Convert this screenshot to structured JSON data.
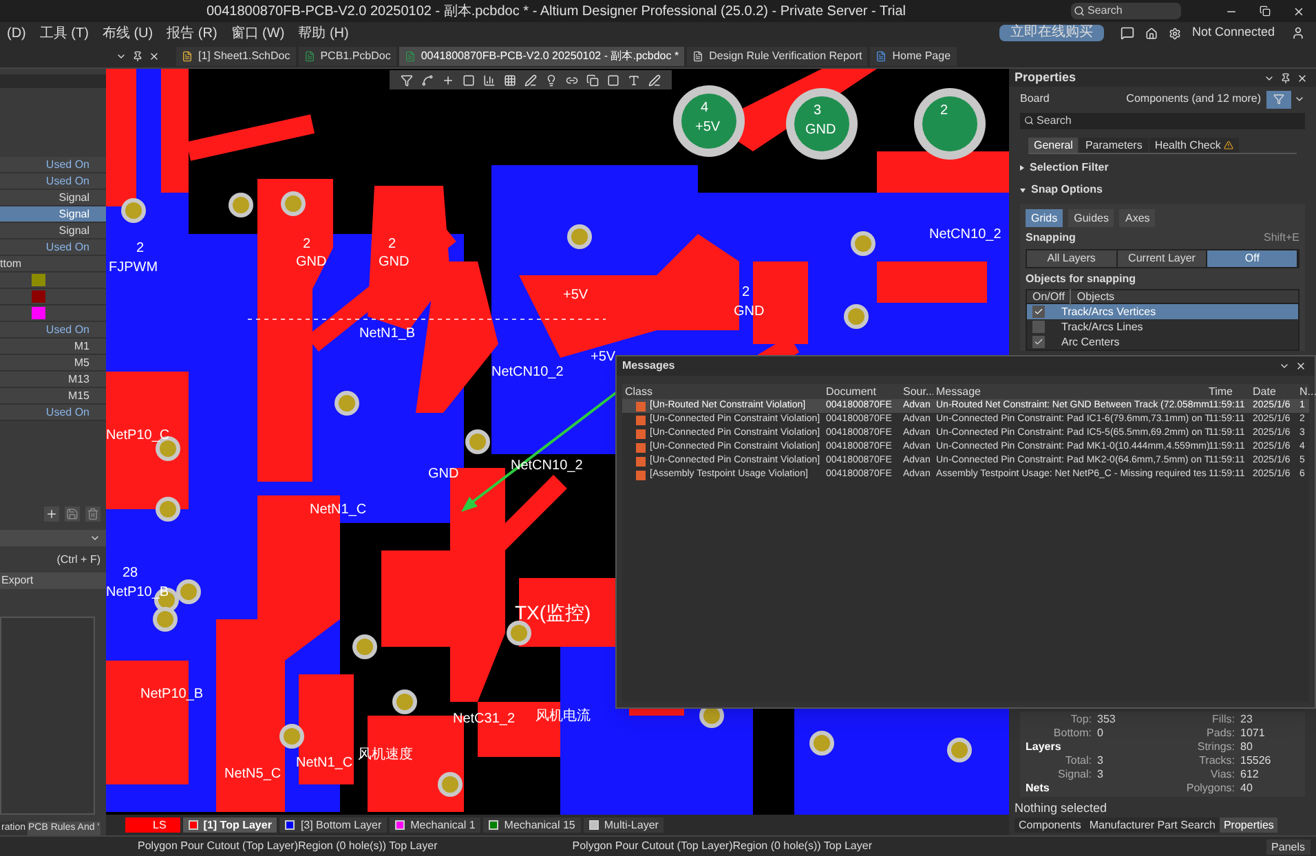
{
  "title_bar": {
    "title": "0041800870FB-PCB-V2.0 20250102 - 副本.pcbdoc * - Altium Designer Professional (25.0.2) - Private Server - Trial",
    "search": {
      "placeholder": "Search"
    }
  },
  "menu_bar": {
    "items": [
      "(D)",
      "工具 (T)",
      "布线 (U)",
      "报告 (R)",
      "窗口 (W)",
      "帮助 (H)"
    ],
    "buy_button": "立即在线购买",
    "connection": "Not Connected"
  },
  "doc_tabs": [
    {
      "label": "[1] Sheet1.SchDoc",
      "kind": "sch",
      "selected": false
    },
    {
      "label": "PCB1.PcbDoc",
      "kind": "pcb",
      "selected": false
    },
    {
      "label": "0041800870FB-PCB-V2.0 20250102 - 副本.pcbdoc *",
      "kind": "pcb",
      "selected": true
    },
    {
      "label": "Design Rule Verification Report",
      "kind": "report",
      "selected": false
    },
    {
      "label": "Home Page",
      "kind": "home",
      "selected": false
    }
  ],
  "left_panel": {
    "rows": [
      {
        "kind": "link",
        "value": "Used On",
        "selected": false
      },
      {
        "kind": "link",
        "value": "Used On",
        "selected": false
      },
      {
        "kind": "text",
        "value": "Signal",
        "selected": false
      },
      {
        "kind": "text",
        "value": "Signal",
        "selected": true
      },
      {
        "kind": "text",
        "value": "Signal",
        "selected": false
      },
      {
        "kind": "link",
        "value": "Used On",
        "selected": false
      },
      {
        "kind": "label",
        "value": "ttom",
        "selected": false
      },
      {
        "kind": "swatch",
        "color": "#8c8c00",
        "selected": false
      },
      {
        "kind": "swatch",
        "color": "#8c0000",
        "selected": false
      },
      {
        "kind": "swatch",
        "color": "#ff00ff",
        "selected": false
      },
      {
        "kind": "link",
        "value": "Used On",
        "selected": false
      },
      {
        "kind": "text",
        "value": "M1",
        "selected": false
      },
      {
        "kind": "text",
        "value": "M5",
        "selected": false
      },
      {
        "kind": "text",
        "value": "M13",
        "selected": false
      },
      {
        "kind": "text",
        "value": "M15",
        "selected": false
      },
      {
        "kind": "link",
        "value": "Used On",
        "selected": false
      }
    ],
    "shortcut": "(Ctrl + F)",
    "export_button": "Export",
    "bottom_tabs": [
      {
        "label": "ration",
        "selected": false
      },
      {
        "label": "PCB Rules And '",
        "selected": true
      }
    ]
  },
  "canvas": {
    "labels": [
      {
        "text": "2"
      },
      {
        "text": "FJPWM"
      },
      {
        "text": "2"
      },
      {
        "text": "GND"
      },
      {
        "text": "2"
      },
      {
        "text": "GND"
      },
      {
        "text": "NetN1_B"
      },
      {
        "text": "NetCN10_2"
      },
      {
        "text": "+5V"
      },
      {
        "text": "2"
      },
      {
        "text": "GND"
      },
      {
        "text": "NetP10_C"
      },
      {
        "text": "NetCN10_2"
      },
      {
        "text": "GND"
      },
      {
        "text": "NetN1_C"
      },
      {
        "text": "TX(监控)"
      },
      {
        "text": "28"
      },
      {
        "text": "NetP10_B"
      },
      {
        "text": "NetP10_B"
      },
      {
        "text": "NetC31_2"
      },
      {
        "text": "风机电流"
      },
      {
        "text": "NetN1_C"
      },
      {
        "text": "风机速度"
      },
      {
        "text": "NetN5_C"
      },
      {
        "text": "NetCN10_2"
      },
      {
        "text": "+5V"
      },
      {
        "text": "4"
      },
      {
        "text": "+5V"
      },
      {
        "text": "3"
      },
      {
        "text": "GND"
      },
      {
        "text": "2"
      }
    ]
  },
  "properties": {
    "title": "Properties",
    "board_label": "Board",
    "filter_text": "Components (and 12 more)",
    "search": {
      "placeholder": "Search"
    },
    "tabs": [
      {
        "label": "General",
        "selected": true
      },
      {
        "label": "Parameters",
        "selected": false
      },
      {
        "label": "Health Check",
        "selected": false
      }
    ],
    "sections": [
      {
        "label": "Selection Filter",
        "expanded": false
      },
      {
        "label": "Snap Options",
        "expanded": true
      }
    ],
    "grid_buttons": [
      {
        "label": "Grids",
        "selected": true
      },
      {
        "label": "Guides",
        "selected": false
      },
      {
        "label": "Axes",
        "selected": false
      }
    ],
    "snapping_label": "Snapping",
    "snapping_shortcut": "Shift+E",
    "snapping_modes": [
      {
        "label": "All Layers",
        "selected": false
      },
      {
        "label": "Current Layer",
        "selected": false
      },
      {
        "label": "Off",
        "selected": true
      }
    ],
    "objects_heading": "Objects for snapping",
    "objects_columns": [
      "On/Off",
      "Objects"
    ],
    "objects": [
      {
        "label": "Track/Arcs Vertices",
        "checked": true,
        "selected": true
      },
      {
        "label": "Track/Arcs Lines",
        "checked": false,
        "selected": false
      },
      {
        "label": "Arc Centers",
        "checked": true,
        "selected": false
      }
    ],
    "stats_rows": [
      {
        "left": {
          "kind": "pair",
          "label": "Top:",
          "value": "353"
        },
        "right": {
          "label": "Fills:",
          "value": "23"
        }
      },
      {
        "left": {
          "kind": "pair",
          "label": "Bottom:",
          "value": "0"
        },
        "right": {
          "label": "Pads:",
          "value": "1071"
        }
      },
      {
        "left": {
          "kind": "heading",
          "label": "Layers"
        },
        "right": {
          "label": "Strings:",
          "value": "80"
        }
      },
      {
        "left": {
          "kind": "pair",
          "label": "Total:",
          "value": "3"
        },
        "right": {
          "label": "Tracks:",
          "value": "15526"
        }
      },
      {
        "left": {
          "kind": "pair",
          "label": "Signal:",
          "value": "3"
        },
        "right": {
          "label": "Vias:",
          "value": "612"
        }
      },
      {
        "left": {
          "kind": "heading",
          "label": "Nets"
        },
        "right": {
          "label": "Polygons:",
          "value": "40"
        }
      }
    ],
    "selection_status": "Nothing selected",
    "bottom_tabs": [
      {
        "label": "Components",
        "selected": false
      },
      {
        "label": "Manufacturer Part Search",
        "selected": false
      },
      {
        "label": "Properties",
        "selected": true
      }
    ]
  },
  "messages": {
    "title": "Messages",
    "columns": [
      "Class",
      "Document",
      "Sour...",
      "Message",
      "Time",
      "Date",
      "N..."
    ],
    "rows": [
      {
        "class": "[Un-Routed Net Constraint Violation]",
        "document": "0041800870FE",
        "source": "Advan",
        "message": "Un-Routed Net Constraint: Net GND Between Track (72.058mm",
        "time": "11:59:11",
        "date": "2025/1/6",
        "number": "1",
        "selected": true
      },
      {
        "class": "[Un-Connected Pin Constraint Violation]",
        "document": "0041800870FE",
        "source": "Advan",
        "message": "Un-Connected Pin Constraint: Pad IC1-6(79.6mm,73.1mm) on T",
        "time": "11:59:11",
        "date": "2025/1/6",
        "number": "2",
        "selected": false
      },
      {
        "class": "[Un-Connected Pin Constraint Violation]",
        "document": "0041800870FE",
        "source": "Advan",
        "message": "Un-Connected Pin Constraint: Pad IC5-5(65.5mm,69.2mm) on T",
        "time": "11:59:11",
        "date": "2025/1/6",
        "number": "3",
        "selected": false
      },
      {
        "class": "[Un-Connected Pin Constraint Violation]",
        "document": "0041800870FE",
        "source": "Advan",
        "message": "Un-Connected Pin Constraint: Pad MK1-0(10.444mm,4.559mm)",
        "time": "11:59:11",
        "date": "2025/1/6",
        "number": "4",
        "selected": false
      },
      {
        "class": "[Un-Connected Pin Constraint Violation]",
        "document": "0041800870FE",
        "source": "Advan",
        "message": "Un-Connected Pin Constraint: Pad MK2-0(64.6mm,7.5mm) on T",
        "time": "11:59:11",
        "date": "2025/1/6",
        "number": "5",
        "selected": false
      },
      {
        "class": "[Assembly Testpoint Usage Violation]",
        "document": "0041800870FE",
        "source": "Advan",
        "message": "Assembly Testpoint Usage: Net NetP6_C - Missing required tes",
        "time": "11:59:11",
        "date": "2025/1/6",
        "number": "6",
        "selected": false
      }
    ]
  },
  "layer_tabs": [
    {
      "kind": "block",
      "label": "LS",
      "color": "#ff0000",
      "selected": false
    },
    {
      "kind": "layer",
      "label": "[1] Top Layer",
      "color": "#ff0000",
      "selected": true
    },
    {
      "kind": "layer",
      "label": "[3] Bottom Layer",
      "color": "#0000ff",
      "selected": false
    },
    {
      "kind": "layer",
      "label": "Mechanical 1",
      "color": "#ff00ff",
      "selected": false
    },
    {
      "kind": "layer",
      "label": "Mechanical 15",
      "color": "#008000",
      "selected": false
    },
    {
      "kind": "layer",
      "label": "Multi-Layer",
      "color": "#c0c0c0",
      "selected": false
    }
  ],
  "status_bar": {
    "texts": [
      "Polygon Pour Cutout (Top Layer)Region (0 hole(s)) Top Layer",
      "Polygon Pour Cutout (Top Layer)Region (0 hole(s)) Top Layer"
    ],
    "panels_button": "Panels"
  }
}
